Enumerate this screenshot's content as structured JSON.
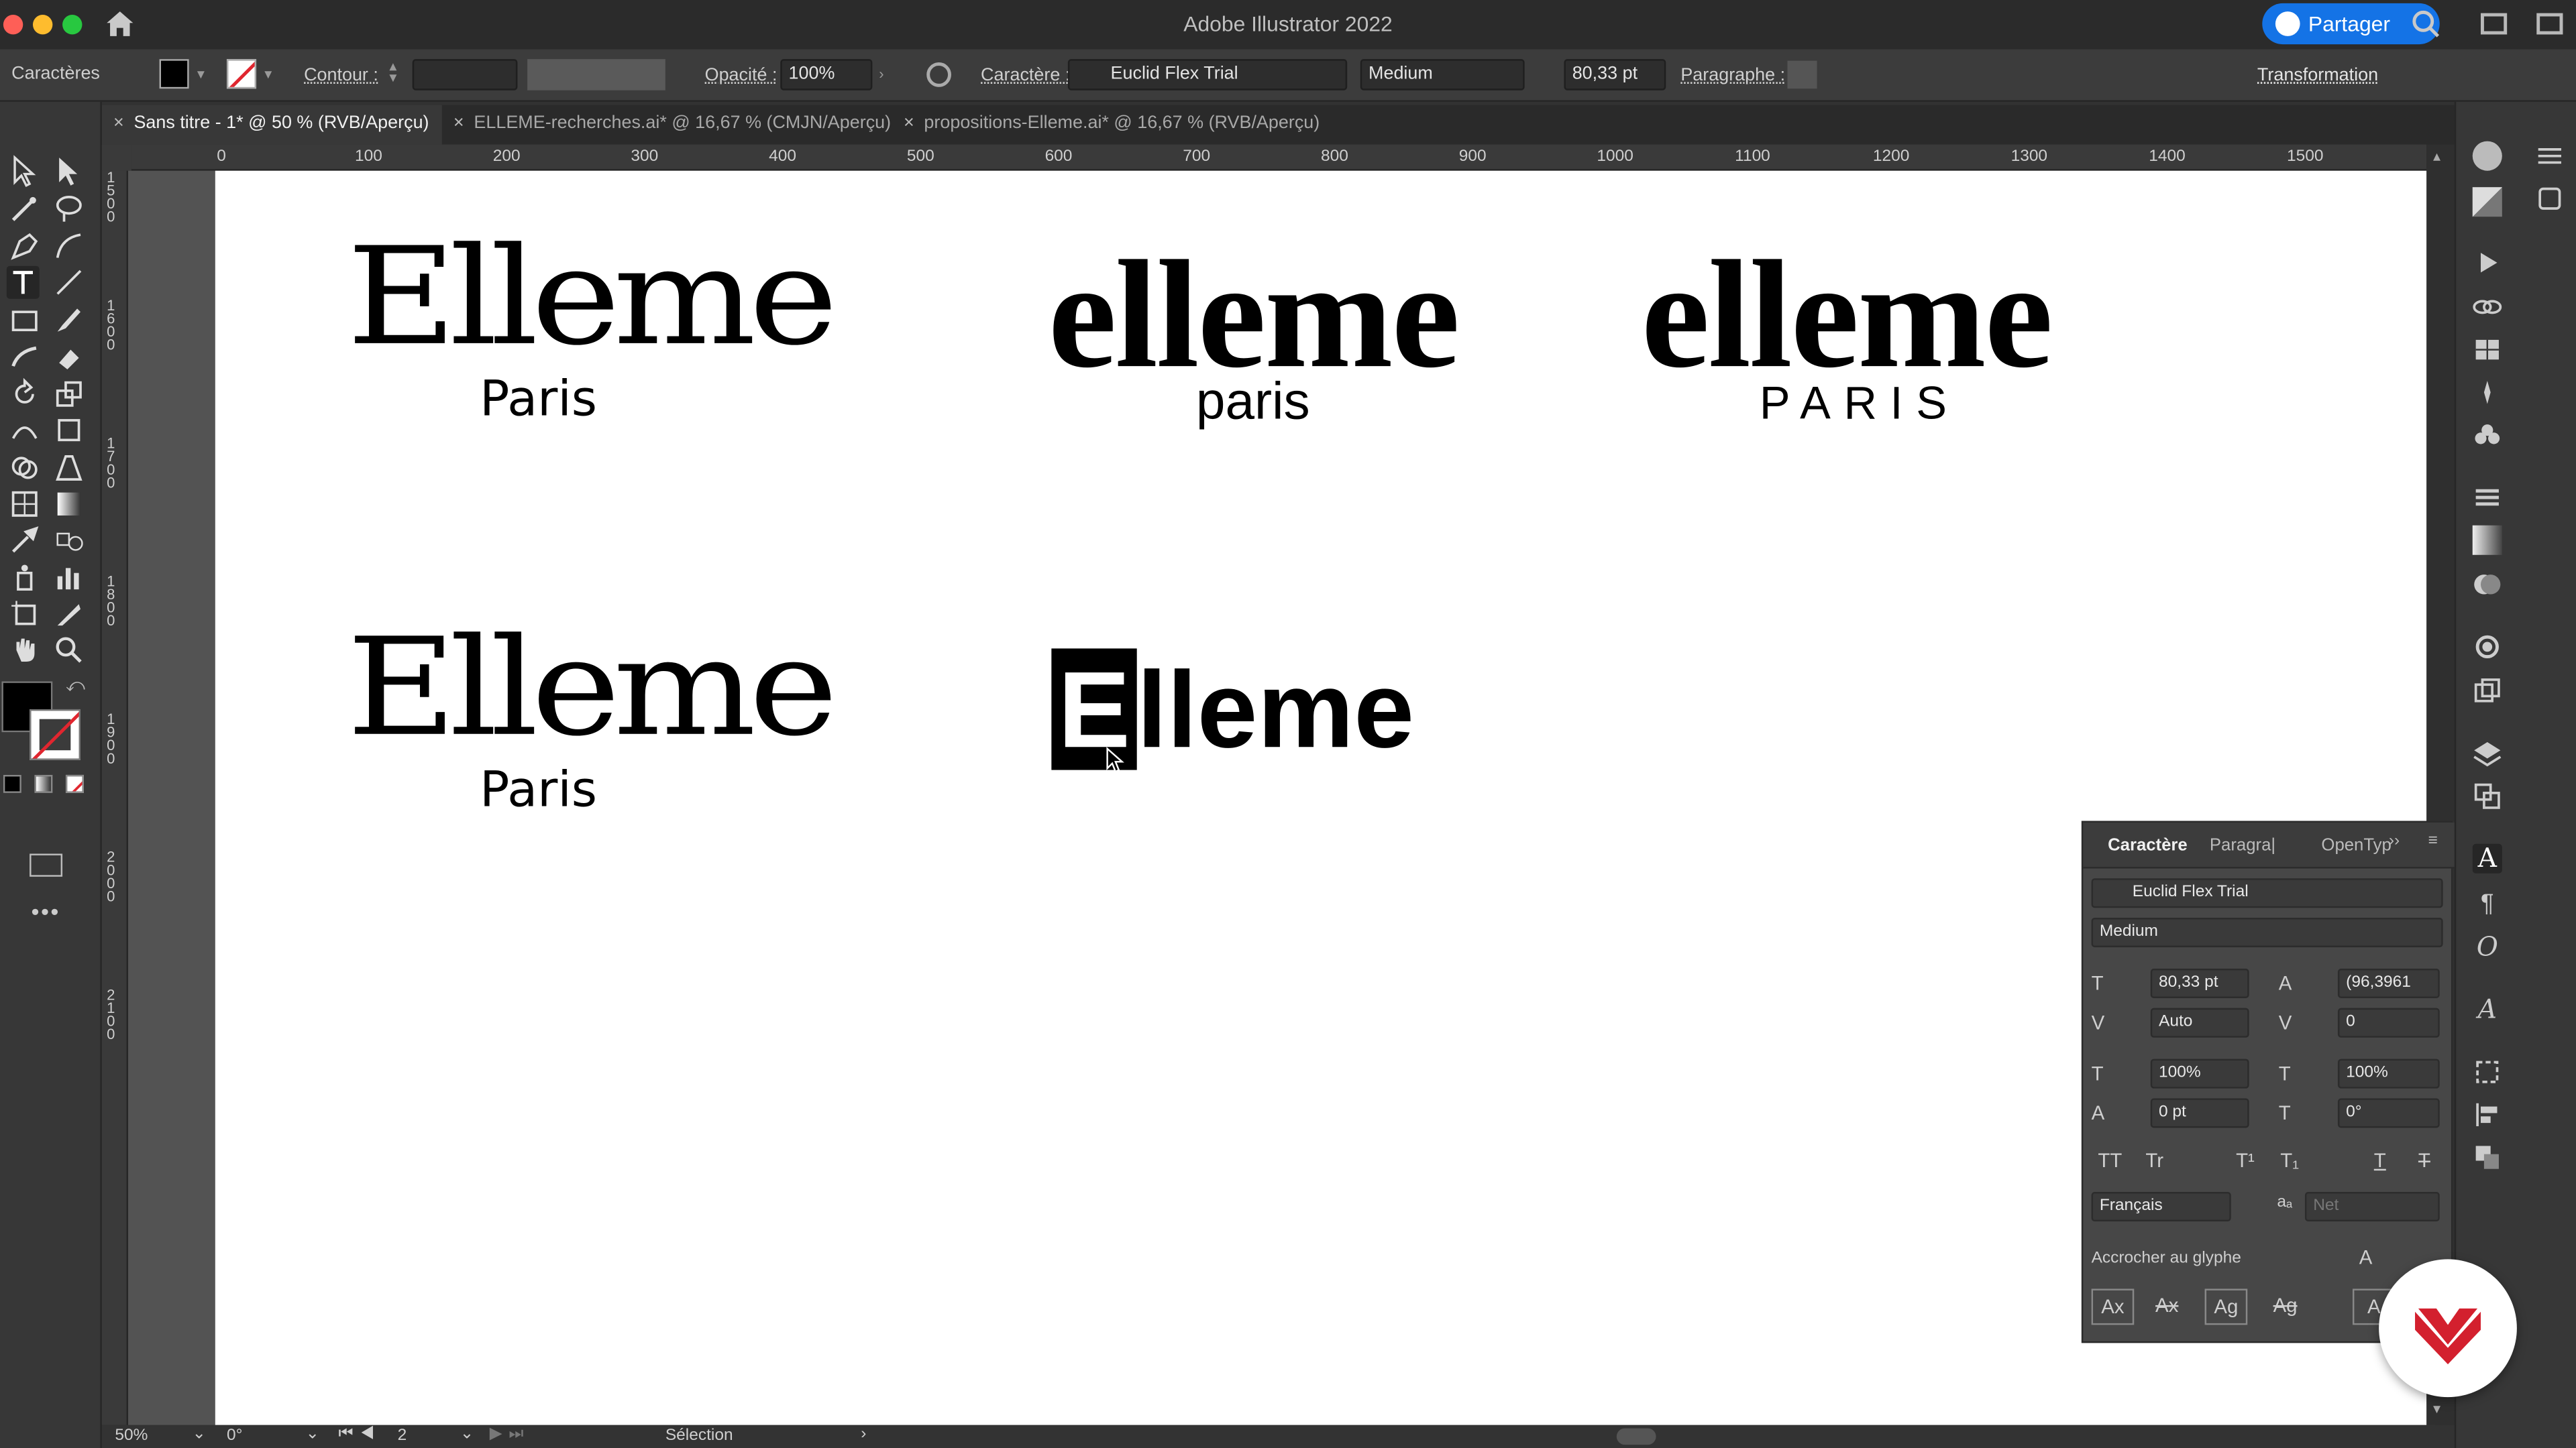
{
  "app": {
    "title": "Adobe Illustrator 2022",
    "share_label": "Partager"
  },
  "control_bar": {
    "mode_label": "Caractères",
    "stroke_label": "Contour :",
    "opacity_label": "Opacité :",
    "opacity_value": "100%",
    "character_label": "Caractère :",
    "font_family": "Euclid Flex Trial",
    "font_style": "Medium",
    "font_size": "80,33 pt",
    "paragraph_label": "Paragraphe :",
    "transform_label": "Transformation"
  },
  "tabs": [
    {
      "label": "Sans titre - 1* @ 50 % (RVB/Aperçu)",
      "active": true
    },
    {
      "label": "ELLEME-recherches.ai* @ 16,67 % (CMJN/Aperçu)",
      "active": false
    },
    {
      "label": "propositions-Elleme.ai* @ 16,67 % (RVB/Aperçu)",
      "active": false
    }
  ],
  "ruler": {
    "top_ticks": [
      "0",
      "100",
      "200",
      "300",
      "400",
      "500",
      "600",
      "700",
      "800",
      "900",
      "1000",
      "1100",
      "1200",
      "1300",
      "1400",
      "1500"
    ],
    "left_ticks": [
      "1500",
      "1600",
      "1700",
      "1800",
      "1900",
      "2000",
      "2100"
    ]
  },
  "logos": [
    {
      "word": "Elleme",
      "sub": "Paris"
    },
    {
      "word": "elleme",
      "sub": "paris"
    },
    {
      "word": "elleme",
      "sub": "PARIS"
    },
    {
      "word": "Elleme",
      "sub": "Paris"
    },
    {
      "word_initial": "E",
      "word_rest": "lleme"
    }
  ],
  "status": {
    "zoom": "50%",
    "rotation": "0°",
    "artboard": "2",
    "tool": "Sélection"
  },
  "character_panel": {
    "tabs": [
      "Caractère",
      "Paragra|",
      "OpenTyp"
    ],
    "font_family": "Euclid Flex Trial",
    "font_style": "Medium",
    "size": "80,33 pt",
    "leading": "(96,3961",
    "kerning": "Auto",
    "tracking": "0",
    "vscale": "100%",
    "hscale": "100%",
    "baseline": "0 pt",
    "rotation": "0°",
    "language": "Français",
    "antialias": "Net",
    "snap_label": "Accrocher au glyphe",
    "case_buttons": [
      "TT",
      "Tr",
      "T¹",
      "T₁",
      "T",
      "T"
    ],
    "glyph_buttons": [
      "Ax",
      "Ax",
      "Ag",
      "Ag",
      "A"
    ]
  },
  "colors": {
    "accent": "#1473e6",
    "badge": "#d3202e"
  }
}
